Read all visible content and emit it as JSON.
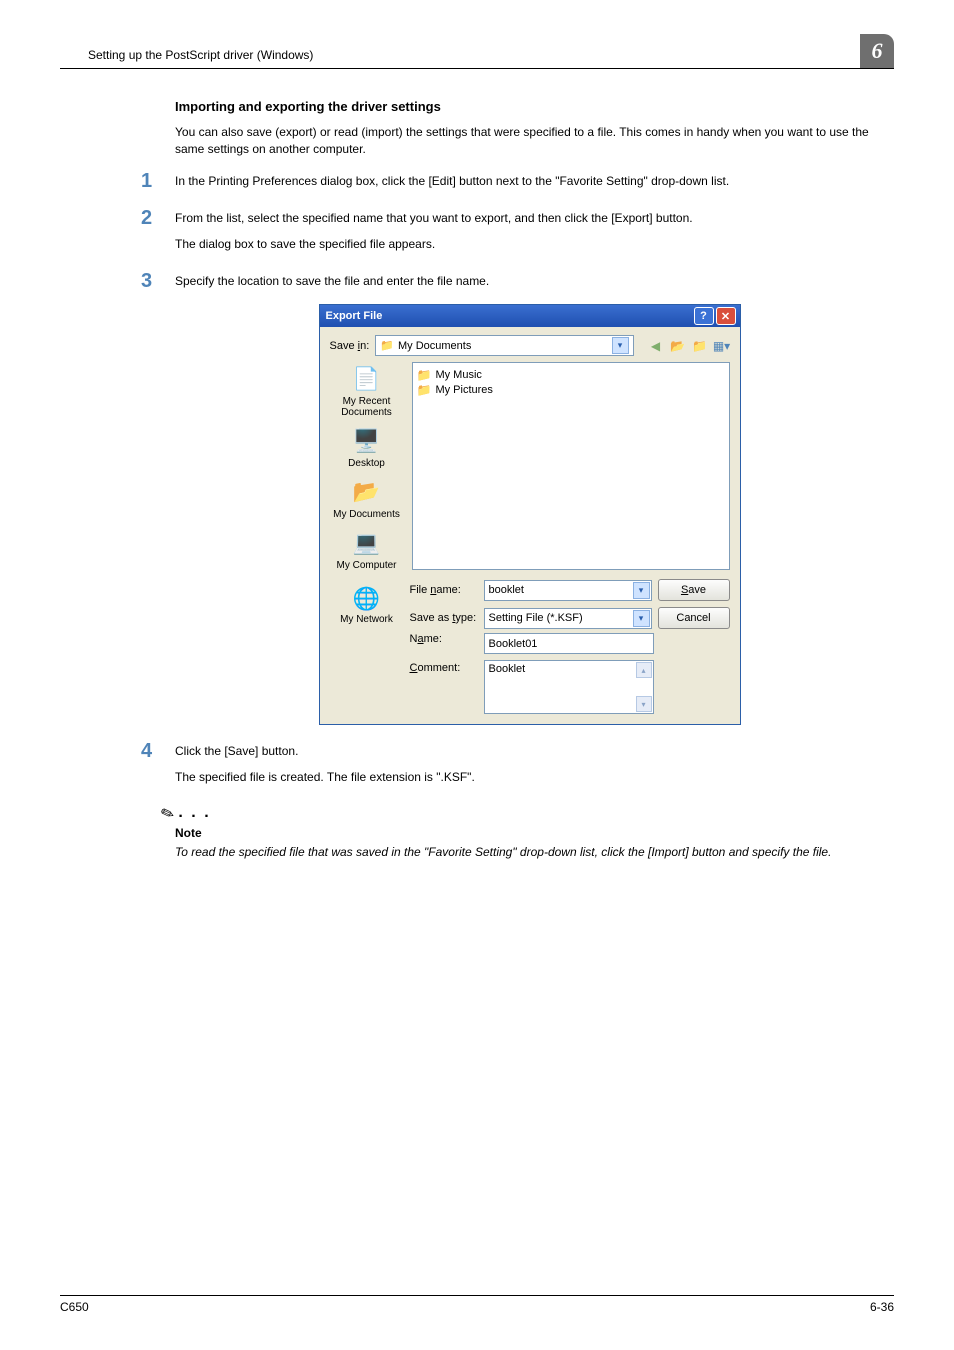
{
  "header": {
    "running_title": "Setting up the PostScript driver (Windows)",
    "chapter_number": "6"
  },
  "subheading": "Importing and exporting the driver settings",
  "intro": "You can also save (export) or read (import) the settings that were specified to a file. This comes in handy when you want to use the same settings on another computer.",
  "steps": {
    "s1": {
      "num": "1",
      "text": "In the Printing Preferences dialog box, click the [Edit] button next to the \"Favorite Setting\" drop-down list."
    },
    "s2": {
      "num": "2",
      "text_a": "From the list, select the specified name that you want to export, and then click the [Export] button.",
      "text_b": "The dialog box to save the specified file appears."
    },
    "s3": {
      "num": "3",
      "text": "Specify the location to save the file and enter the file name."
    },
    "s4": {
      "num": "4",
      "text_a": "Click the [Save] button.",
      "text_b": "The specified file is created. The file extension is \".KSF\"."
    }
  },
  "dialog": {
    "title": "Export File",
    "save_in_label": "Save in:",
    "save_in_value": "My Documents",
    "list_items": [
      "My Music",
      "My Pictures"
    ],
    "sidebar": {
      "recent": "My Recent Documents",
      "desktop": "Desktop",
      "mydocs": "My Documents",
      "mycomputer": "My Computer",
      "network": "My Network"
    },
    "filename_label": "File name:",
    "filename_value": "booklet",
    "saveas_label": "Save as type:",
    "saveas_value": "Setting File (*.KSF)",
    "name_label": "Name:",
    "name_value": "Booklet01",
    "comment_label": "Comment:",
    "comment_value": "Booklet",
    "btn_save": "Save",
    "btn_cancel": "Cancel"
  },
  "note": {
    "label": "Note",
    "text": "To read the specified file that was saved in the \"Favorite Setting\" drop-down list, click the [Import] button and specify the file."
  },
  "footer": {
    "left": "C650",
    "right": "6-36"
  }
}
